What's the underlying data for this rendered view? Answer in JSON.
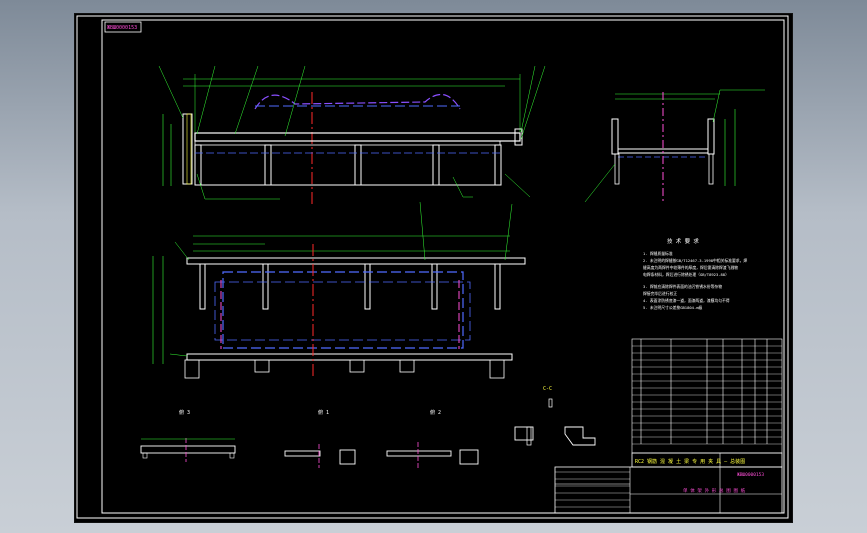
{
  "drawing": {
    "sheet_tag": "ЖВШ0000153",
    "tech_title": "技 术 要 求",
    "tech_notes": [
      "1. 焊缝质量标准",
      "2. 未注明的焊缝按GB/T12467.3-1998中相关标准要求，焊",
      "   缝高度为两焊件中较薄件的厚度，焊后需清除焊渣飞溅物",
      "   电焊条材料，焊后进行除锈处理（GB/T8923-88）",
      "3. 焊前应清除焊件表面的油污铁锈水份等杂物",
      "   焊接完毕后进行校正",
      "4. 表面涂防锈底漆一道，面漆两道，漆膜均匀不得",
      "5. 未注明尺寸公差按GB1804-m级"
    ],
    "title_main": "RC2 钢筋 混 凝 土 梁 专 用 夹 具 — 总装图",
    "title_sub": "单 体 架 外 形 总 图 图 纸",
    "company": "ЖВШ0000153",
    "view_labels": [
      "俯 3",
      "俯 1",
      "俯 2"
    ],
    "section_label": "C-C"
  }
}
